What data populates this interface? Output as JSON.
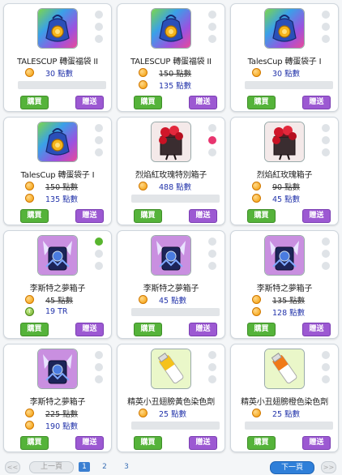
{
  "items": [
    {
      "name": "TALESCUP 轉蛋福袋 II",
      "icon": "bag-icon",
      "prices": [
        {
          "text": "30 點數",
          "old": false,
          "currency": "coin"
        }
      ],
      "bar": true,
      "dots": [
        "off",
        "off",
        "off"
      ]
    },
    {
      "name": "TALESCUP 轉蛋福袋 II",
      "icon": "bag-icon",
      "prices": [
        {
          "text": "150 點數",
          "old": true,
          "currency": "coin"
        },
        {
          "text": "135 點數",
          "old": false,
          "currency": "coin"
        }
      ],
      "bar": false,
      "dots": [
        "off",
        "off",
        "off"
      ]
    },
    {
      "name": "TalesCup 轉蛋袋子 I",
      "icon": "bag-icon",
      "prices": [
        {
          "text": "30 點數",
          "old": false,
          "currency": "coin"
        }
      ],
      "bar": true,
      "dots": [
        "off",
        "off",
        "off"
      ]
    },
    {
      "name": "TalesCup 轉蛋袋子 I",
      "icon": "bag-icon",
      "prices": [
        {
          "text": "150 點數",
          "old": true,
          "currency": "coin"
        },
        {
          "text": "135 點數",
          "old": false,
          "currency": "coin"
        }
      ],
      "bar": false,
      "dots": [
        "off",
        "off",
        "off"
      ]
    },
    {
      "name": "烈焰紅玫瑰特別箱子",
      "icon": "rose-box-icon",
      "prices": [
        {
          "text": "488 點數",
          "old": false,
          "currency": "coin"
        }
      ],
      "bar": true,
      "dots": [
        "off",
        "pink",
        "off"
      ]
    },
    {
      "name": "烈焰紅玫瑰箱子",
      "icon": "rose-box-icon",
      "prices": [
        {
          "text": "90 點數",
          "old": true,
          "currency": "coin"
        },
        {
          "text": "45 點數",
          "old": false,
          "currency": "coin"
        }
      ],
      "bar": false,
      "dots": [
        "off",
        "off",
        "off"
      ]
    },
    {
      "name": "李斯特之夢箱子",
      "icon": "dream-box-icon",
      "prices": [
        {
          "text": "45 點數",
          "old": true,
          "currency": "coin"
        },
        {
          "text": "19 TR",
          "old": false,
          "currency": "tr"
        }
      ],
      "bar": false,
      "dots": [
        "on",
        "off",
        "off"
      ]
    },
    {
      "name": "李斯特之夢箱子",
      "icon": "dream-box-icon",
      "prices": [
        {
          "text": "45 點數",
          "old": false,
          "currency": "coin"
        }
      ],
      "bar": true,
      "dots": [
        "off",
        "off",
        "off"
      ]
    },
    {
      "name": "李斯特之夢箱子",
      "icon": "dream-box-icon",
      "prices": [
        {
          "text": "135 點數",
          "old": true,
          "currency": "coin"
        },
        {
          "text": "128 點數",
          "old": false,
          "currency": "coin"
        }
      ],
      "bar": false,
      "dots": [
        "off",
        "off",
        "off"
      ]
    },
    {
      "name": "李斯特之夢箱子",
      "icon": "dream-box-icon",
      "prices": [
        {
          "text": "225 點數",
          "old": true,
          "currency": "coin"
        },
        {
          "text": "190 點數",
          "old": false,
          "currency": "coin"
        }
      ],
      "bar": false,
      "dots": [
        "off",
        "off",
        "off"
      ]
    },
    {
      "name": "精英小丑翅膀黃色染色劑",
      "icon": "yellow-dye-icon",
      "prices": [
        {
          "text": "25 點數",
          "old": false,
          "currency": "coin"
        }
      ],
      "bar": true,
      "dots": [
        "off",
        "off",
        "off"
      ]
    },
    {
      "name": "精英小丑翅膀橙色染色劑",
      "icon": "orange-dye-icon",
      "prices": [
        {
          "text": "25 點數",
          "old": false,
          "currency": "coin"
        }
      ],
      "bar": true,
      "dots": [
        "off",
        "off",
        "off"
      ]
    }
  ],
  "buttons": {
    "buy": "購買",
    "gift": "贈送"
  },
  "pager": {
    "prev": "上一頁",
    "next": "下一頁",
    "pages": [
      "1",
      "2",
      "3"
    ],
    "current": "1",
    "first": "<<",
    "last": ">>"
  }
}
